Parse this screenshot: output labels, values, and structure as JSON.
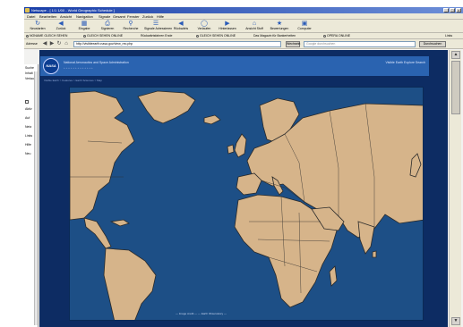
{
  "window": {
    "title": "Netscape - [ 1/1 1/00 - World Geographic Schedule ]",
    "controls": [
      "_",
      "□",
      "×"
    ]
  },
  "menu": [
    "Datei",
    "Bearbeiten",
    "Ansicht",
    "Navigation",
    "Signale",
    "Gesamt",
    "Fenster",
    "Zurück",
    "Hilfe"
  ],
  "toolbar": [
    {
      "label": "Neustarten",
      "icon": "reload-icon"
    },
    {
      "label": "Zurück",
      "icon": "back-icon"
    },
    {
      "label": "Eingabe",
      "icon": "input-icon"
    },
    {
      "label": "Signieren",
      "icon": "print-icon"
    },
    {
      "label": "Recherche",
      "icon": "search-icon"
    },
    {
      "label": "Signale Adressieren",
      "icon": "signal-icon"
    },
    {
      "label": "Rückwärts",
      "icon": "rewind-icon"
    },
    {
      "label": "Verlaufen",
      "icon": "history-icon"
    },
    {
      "label": "Hinterlassen",
      "icon": "forward-icon"
    },
    {
      "label": "Ansicht Stoff",
      "icon": "home-icon"
    },
    {
      "label": "Bewertungen",
      "icon": "rating-icon"
    },
    {
      "label": "Computer",
      "icon": "computer-icon"
    }
  ],
  "links": [
    "NONAME GLEICH SEHEN",
    "GLEICH SEHEN ONLINE",
    "Rückwärtsfahren Ende",
    "GLEICH SEHEN ONLINE",
    "Das Magazin für Bankerheiten",
    "OPERA ONLINE",
    "Links"
  ],
  "address": {
    "label": "Adresse",
    "value": "http://visibleearth.nasa.gov/view_rec.php",
    "go_label": "Wechseln",
    "search_placeholder": "Google durchsuchen",
    "search_button": "Durchsuchen"
  },
  "side_panel": {
    "items": [
      "Suche",
      "Inhalt",
      "Verlauf",
      "Aktiv",
      "Auf",
      "Netz",
      "Links",
      "Hilfe",
      "Neu"
    ]
  },
  "page": {
    "logo_text": "NASA",
    "header_title": "National Aeronautics and Space Administration",
    "header_subtitle": "+ + + + + + + + + + + + +",
    "header_links": "Visible Earth   Explore   Search",
    "breadcrumb": "Visible Earth > Features > Earth Sciences > Map",
    "map_caption": "— Image credit —  — Earth Observatory —"
  },
  "colors": {
    "page_bg": "#0d2c63",
    "header": "#2a63b0",
    "ocean": "#1d4f86",
    "land": "#d6b48a",
    "border": "#2a2a2a"
  }
}
